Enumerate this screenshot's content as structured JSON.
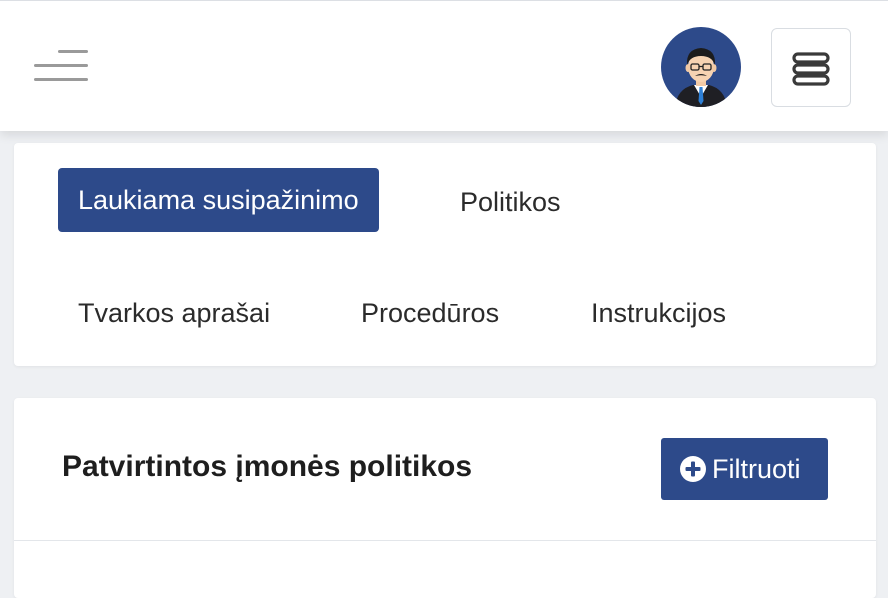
{
  "header": {
    "menu_icon": "hamburger-icon",
    "avatar_icon": "user-avatar",
    "options_icon": "stack-menu-icon"
  },
  "tabs": [
    {
      "label": "Laukiama susipažinimo",
      "active": true
    },
    {
      "label": "Politikos",
      "active": false
    },
    {
      "label": "Tvarkos aprašai",
      "active": false
    },
    {
      "label": "Procedūros",
      "active": false
    },
    {
      "label": "Instrukcijos",
      "active": false
    }
  ],
  "list": {
    "title": "Patvirtintos įmonės politikos",
    "filter_label": "Filtruoti",
    "filter_icon": "plus-circle-icon"
  },
  "colors": {
    "primary": "#2d4a8a",
    "background": "#eef0f3",
    "card": "#ffffff"
  }
}
